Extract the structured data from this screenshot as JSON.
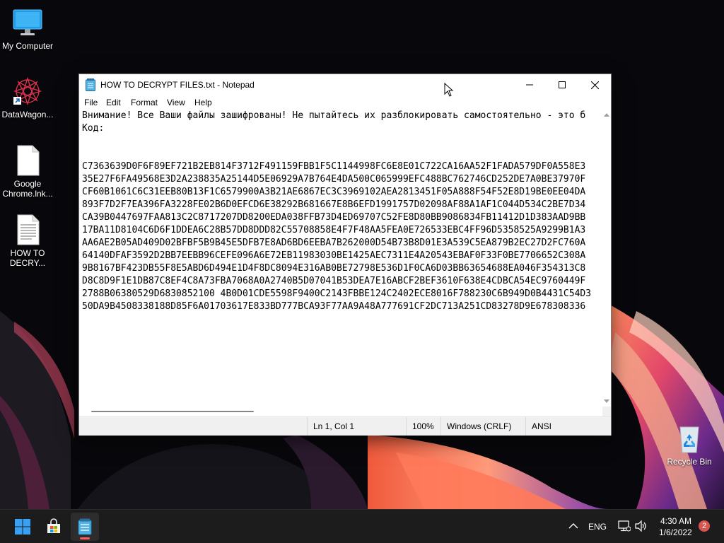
{
  "desktop": {
    "icons": [
      {
        "label": "My Computer",
        "icon": "monitor-icon"
      },
      {
        "label": "DataWagon...",
        "icon": "datawagon-shortcut-icon"
      },
      {
        "label": "Google\nChrome.lnk...",
        "icon": "document-icon"
      },
      {
        "label": "HOW TO\nDECRY...",
        "icon": "text-file-icon"
      },
      {
        "label": "Recycle Bin",
        "icon": "recycle-bin-icon"
      }
    ]
  },
  "notepad": {
    "title": "HOW TO DECRYPT FILES.txt - Notepad",
    "menu": [
      "File",
      "Edit",
      "Format",
      "View",
      "Help"
    ],
    "lines": [
      "Внимание! Все Ваши файлы зашифрованы! Не пытайтесь их разблокировать самостоятельно - это б",
      "Код:",
      "",
      "",
      "C7363639D0F6F89EF721B2EB814F3712F491159FBB1F5C1144998FC6E8E01C722CA16AA52F1FADA579DF0A558E3",
      "35E27F6FA49568E3D2A238835A25144D5E06929A7B764E4DA500C065999EFC488BC762746CD252DE7A0BE37970F",
      "CF60B1061C6C31EEB80B13F1C6579900A3B21AE6867EC3C3969102AEA2813451F05A888F54F52E8D19BE0EE04DA",
      "893F7D2F7EA396FA3228FE02B6D0EFCD6E38292B681667E8B6EFD1991757D02098AF88A1AF1C044D534C2BE7D34",
      "CA39B0447697FAA813C2C8717207DD8200EDA038FFB73D4ED69707C52FE8D80BB9086834FB11412D1D383AAD9BB",
      "17BA11D8104C6D6F1DDEA6C28B57DD8DDD82C55708858E4F7F48AA5FEA0E726533EBC4FF96D5358525A9299B1A3",
      "AA6AE2B05AD409D02BFBF5B9B45E5DFB7E8AD6BD6EEBA7B262000D54B73B8D01E3A539C5EA879B2EC27D2FC760A",
      "64140DFAF3592D2BB7EEBB96CEFE096A6E72EB11983030BE1425AEC7311E4A20543EBAF0F33F0BE7706652C308A",
      "9B8167BF423DB55F8E5ABD6D494E1D4F8DC8094E316AB0BE72798E536D1F0CA6D03BB63654688EA046F354313C8",
      "D8C8D9F1E1DB87C8EF4C8A73FBA7068A0A2740B5D07041B53DEA7E16ABCF2BEF3610F638E4CDBCA54EC9760449F",
      "2788B06380529D6830852100 4B0D01CDE5598F9400C2143FBBE124C2402ECE8016F788230C6B949D0B4431C54D3",
      "50DA9B4508338188D85F6A01703617E833BD777BCA93F77AA9A48A777691CF2DC713A251CD83278D9E678308336"
    ],
    "status": {
      "position": "Ln 1, Col 1",
      "zoom": "100%",
      "line_ending": "Windows (CRLF)",
      "encoding": "ANSI"
    }
  },
  "taskbar": {
    "tray": {
      "language": "ENG",
      "time": "4:30 AM",
      "date": "1/6/2022",
      "notifications": "2"
    }
  }
}
